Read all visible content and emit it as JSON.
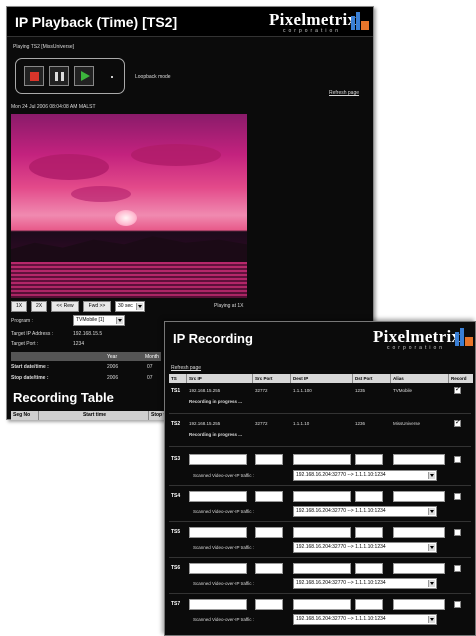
{
  "playback": {
    "title": "IP Playback (Time) [TS2]",
    "logo": {
      "name": "Pixelmetrix",
      "tagline": "corporation"
    },
    "playing_label": "Playing TS2 [MissUniverse]",
    "controls": {
      "stop": "stop",
      "pause": "pause",
      "play": "play"
    },
    "loopback_label": "Loopback mode",
    "refresh_link": "Refresh page",
    "timestamp": "Mon 24 Jul 2006 08:04:08 AM MALST",
    "speed_buttons": [
      "1X",
      "2X",
      "<< Rew",
      "Fwd >>"
    ],
    "seek_select": "30 sec",
    "status": "Playing at 1X",
    "program_label": "Program :",
    "program_value": "TVMobile [1]",
    "target_ip_label": "Target IP Address :",
    "target_ip_value": "192.168.15.5",
    "target_port_label": "Target Port :",
    "target_port_value": "1234",
    "datetime_headers": [
      "Year",
      "Month"
    ],
    "start_label": "Start date/time :",
    "start_values": [
      "2006",
      "07"
    ],
    "stop_label": "Stop date/time :",
    "stop_values": [
      "2006",
      "07"
    ],
    "recording_table_title": "Recording Table",
    "recording_table_headers": [
      "Seg No",
      "Start time",
      "Stop t"
    ]
  },
  "recording": {
    "title": "IP Recording",
    "logo": {
      "name": "Pixelmetrix",
      "tagline": "corporation"
    },
    "refresh_link": "Refresh page",
    "headers": [
      "TS",
      "Src IP",
      "Src Port",
      "Dest IP",
      "Dst Port",
      "Alias",
      "Record"
    ],
    "active_rows": [
      {
        "ts": "TS1",
        "src_ip": "192.168.15.255",
        "src_port": "32772",
        "dest_ip": "1.1.1.100",
        "dst_port": "1235",
        "alias": "TVMobile",
        "status": "Recording in progress ..."
      },
      {
        "ts": "TS2",
        "src_ip": "192.168.15.255",
        "src_port": "32772",
        "dest_ip": "1.1.1.10",
        "dst_port": "1236",
        "alias": "MissUniverse",
        "status": "Recording in progress ..."
      }
    ],
    "empty_rows": [
      {
        "ts": "TS3",
        "scan_label": "Scanned Video-over-IP traffic :",
        "scan_value": "192.168.16.204:32770 --> 1.1.1.10:1234"
      },
      {
        "ts": "TS4",
        "scan_label": "Scanned Video-over-IP traffic :",
        "scan_value": "192.168.16.204:32770 --> 1.1.1.10:1234"
      },
      {
        "ts": "TS5",
        "scan_label": "Scanned Video-over-IP traffic :",
        "scan_value": "192.168.16.204:32770 --> 1.1.1.10:1234"
      },
      {
        "ts": "TS6",
        "scan_label": "Scanned Video-over-IP traffic :",
        "scan_value": "192.168.16.204:32770 --> 1.1.1.10:1234"
      },
      {
        "ts": "TS7",
        "scan_label": "Scanned Video-over-IP traffic :",
        "scan_value": "192.168.16.204:32770 --> 1.1.1.10:1234"
      }
    ]
  },
  "colors": {
    "background": "#0b0b0b",
    "accent_yellow": "#d8c34a",
    "link_blue": "#6aa4ff",
    "logo_orange": "#e8752a",
    "logo_blue": "#3a7fd5"
  }
}
